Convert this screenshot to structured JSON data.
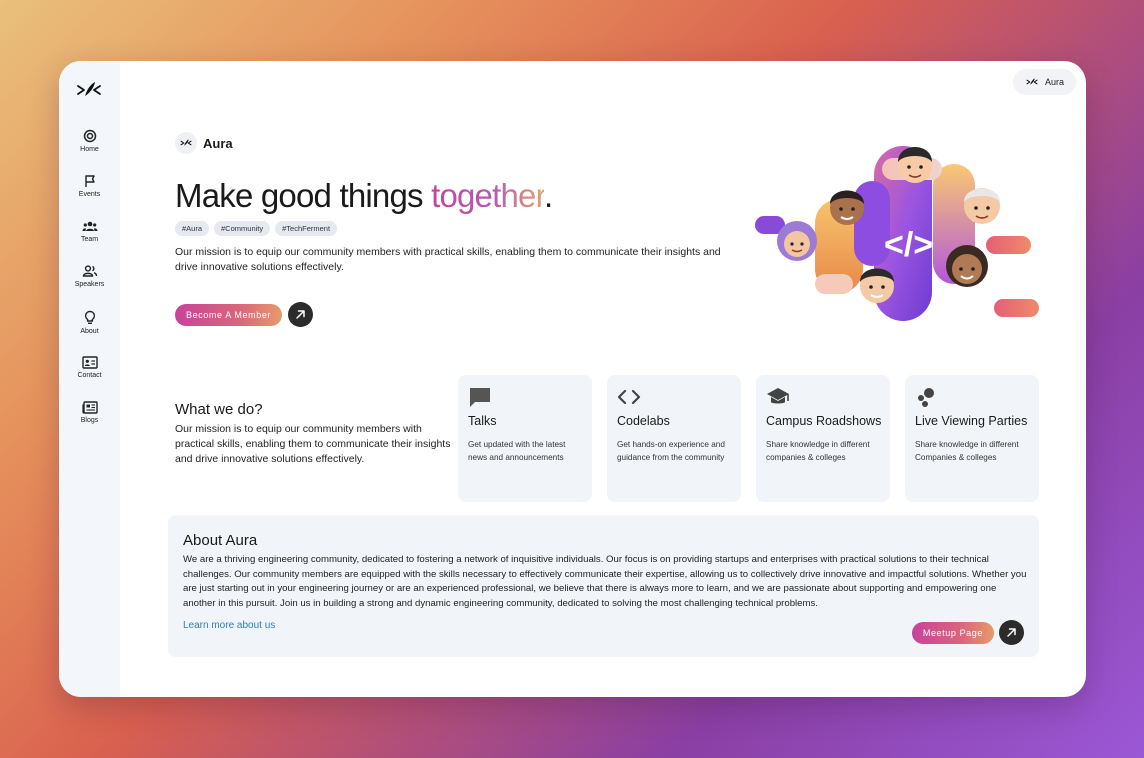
{
  "app": {
    "name": "Aura"
  },
  "top_chip": {
    "label": "Aura"
  },
  "sidebar": {
    "items": [
      {
        "label": "Home",
        "icon": "home-icon"
      },
      {
        "label": "Events",
        "icon": "flag-icon"
      },
      {
        "label": "Team",
        "icon": "team-icon"
      },
      {
        "label": "Speakers",
        "icon": "speakers-icon"
      },
      {
        "label": "About",
        "icon": "lightbulb-icon"
      },
      {
        "label": "Contact",
        "icon": "contact-card-icon"
      },
      {
        "label": "Blogs",
        "icon": "newspaper-icon"
      }
    ]
  },
  "hero": {
    "brand": "Aura",
    "title_main": "Make good things ",
    "title_accent": "together",
    "title_end": ".",
    "tags": [
      "#Aura",
      "#Community",
      "#TechFerment"
    ],
    "mission": "Our mission is to equip our community members with practical skills, enabling them to communicate their insights and drive innovative solutions effectively.",
    "cta_label": "Become A Member"
  },
  "what_we_do": {
    "title": "What we do?",
    "text": "Our mission is to equip our community members with practical skills, enabling them to communicate their insights and drive innovative solutions effectively.",
    "cards": [
      {
        "title": "Talks",
        "desc": "Get updated with the latest news and announcements",
        "icon": "chat-bubble-icon"
      },
      {
        "title": "Codelabs",
        "desc": "Get hands-on experience and guidance from the community",
        "icon": "code-icon"
      },
      {
        "title": "Campus Roadshows",
        "desc": "Share knowledge in different companies & colleges",
        "icon": "graduation-cap-icon"
      },
      {
        "title": "Live Viewing Parties",
        "desc": "Share knowledge in different Companies & colleges",
        "icon": "bubbles-icon"
      }
    ]
  },
  "about": {
    "title": "About Aura",
    "text": "We are a thriving engineering community, dedicated to fostering a network of inquisitive individuals. Our focus is on providing startups and enterprises with practical solutions to their technical challenges. Our community members are equipped with the skills necessary to effectively communicate their expertise, allowing us to collectively drive innovative and impactful solutions. Whether you are just starting out in your engineering journey or are an experienced professional, we believe that there is always more to learn, and we are passionate about supporting and empowering one another in this pursuit. Join us in building a strong and dynamic engineering community, dedicated to solving the most challenging technical problems.",
    "link_label": "Learn more about us",
    "cta_label": "Meetup Page"
  },
  "colors": {
    "accent_start": "#c8439b",
    "accent_end": "#e79a6a",
    "link": "#2a7fc1",
    "card_bg": "#f1f5f9"
  }
}
